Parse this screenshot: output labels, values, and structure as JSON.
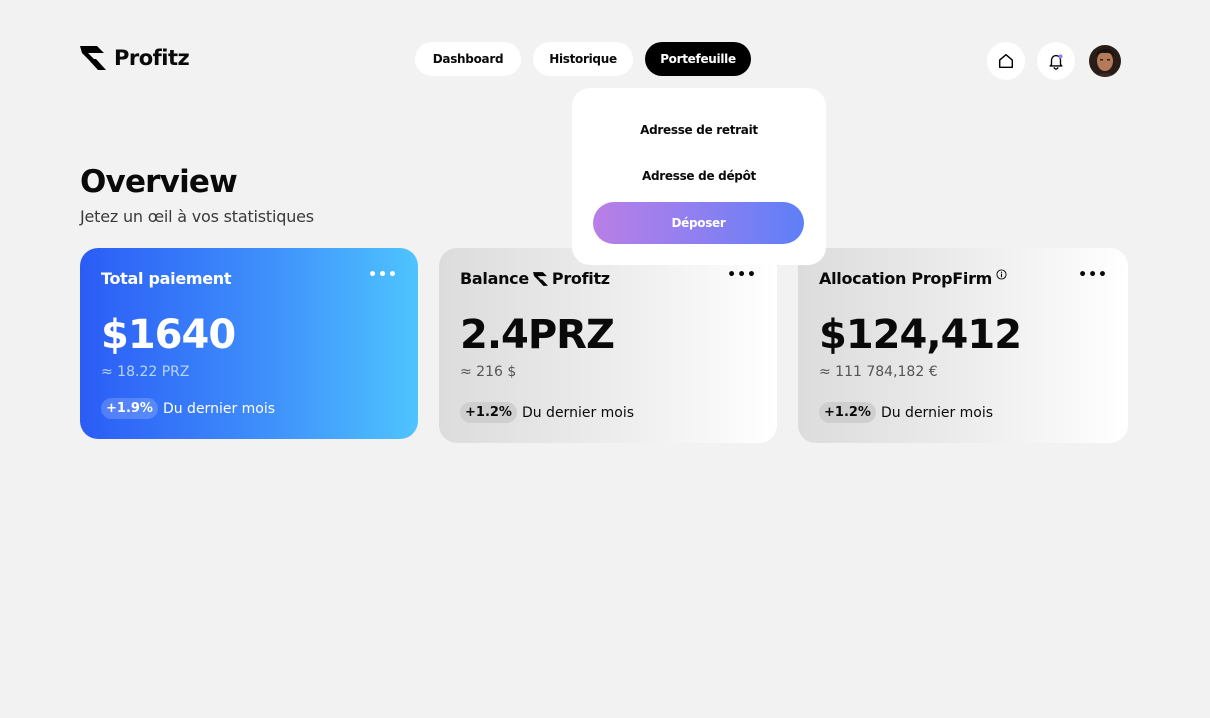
{
  "brand": {
    "name": "Profitz"
  },
  "nav": {
    "items": [
      {
        "label": "Dashboard"
      },
      {
        "label": "Historique"
      },
      {
        "label": "Portefeuille"
      }
    ]
  },
  "dropdown": {
    "withdraw_label": "Adresse de retrait",
    "deposit_address_label": "Adresse de dépôt",
    "deposit_button": "Déposer"
  },
  "overview": {
    "title": "Overview",
    "subtitle": "Jetez un œil à vos statistiques"
  },
  "cards": [
    {
      "title": "Total paiement",
      "amount": "$1640",
      "conversion": "≈ 18.22 PRZ",
      "change": "+1.9%",
      "period": "Du dernier mois"
    },
    {
      "title_prefix": "Balance",
      "title_brand": "Profitz",
      "amount": "2.4PRZ",
      "conversion": "≈ 216 $",
      "change": "+1.2%",
      "period": "Du dernier mois"
    },
    {
      "title": "Allocation PropFirm",
      "amount": "$124,412",
      "conversion": "≈ 111 784,182 €",
      "change": "+1.2%",
      "period": "Du dernier mois"
    }
  ],
  "icons": {
    "home": "home-icon",
    "bell": "bell-icon",
    "info": "info-icon",
    "more": "more-dots-icon"
  },
  "colors": {
    "accent_blue": "#2b5cf6",
    "accent_cyan": "#4ec4fd",
    "deposit_gradient_start": "#b97fe6",
    "deposit_gradient_end": "#5d7ff7"
  }
}
